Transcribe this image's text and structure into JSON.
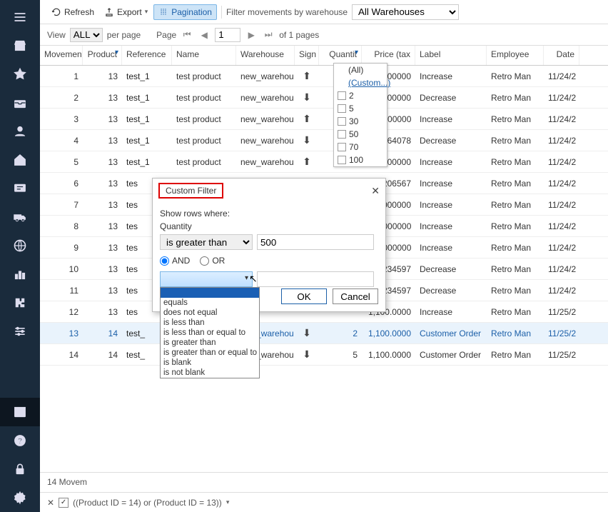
{
  "sidebar": {
    "items": [
      "menu",
      "store",
      "star",
      "inbox",
      "user",
      "home",
      "chat",
      "truck",
      "globe",
      "chart",
      "puzzle",
      "sliders",
      "archive",
      "help",
      "lock",
      "gear"
    ]
  },
  "toolbar": {
    "refresh": "Refresh",
    "export": "Export",
    "pagination": "Pagination",
    "filter_label": "Filter movements by warehouse",
    "warehouse_selected": "All Warehouses"
  },
  "pager": {
    "view": "View",
    "all": "ALL",
    "perpage": "per page",
    "page": "Page",
    "current": "1",
    "of": "of 1 pages"
  },
  "columns": {
    "movement": "Movement",
    "product": "Product",
    "reference": "Reference",
    "name": "Name",
    "warehouse": "Warehouse",
    "sign": "Sign",
    "quantity": "Quantit",
    "price": "Price (tax",
    "label": "Label",
    "employee": "Employee",
    "date": "Date"
  },
  "rows": [
    {
      "mov": "1",
      "prod": "13",
      "ref": "test_1",
      "name": "test product",
      "wh": "new_warehou",
      "sign": "up",
      "qty": "",
      "price": "111.000000",
      "label": "Increase",
      "emp": "Retro Man",
      "date": "11/24/2"
    },
    {
      "mov": "2",
      "prod": "13",
      "ref": "test_1",
      "name": "test product",
      "wh": "new_warehou",
      "sign": "down",
      "qty": "",
      "price": "111.000000",
      "label": "Decrease",
      "emp": "Retro Man",
      "date": "11/24/2"
    },
    {
      "mov": "3",
      "prod": "13",
      "ref": "test_1",
      "name": "test product",
      "wh": "new_warehou",
      "sign": "up",
      "qty": "",
      "price": "120.000000",
      "label": "Increase",
      "emp": "Retro Man",
      "date": "11/24/2"
    },
    {
      "mov": "4",
      "prod": "13",
      "ref": "test_1",
      "name": "test product",
      "wh": "new_warehou",
      "sign": "down",
      "qty": "",
      "price": "118.864078",
      "label": "Decrease",
      "emp": "Retro Man",
      "date": "11/24/2"
    },
    {
      "mov": "5",
      "prod": "13",
      "ref": "test_1",
      "name": "test product",
      "wh": "new_warehou",
      "sign": "up",
      "qty": "",
      "price": "110.000000",
      "label": "Increase",
      "emp": "Retro Man",
      "date": "11/24/2"
    },
    {
      "mov": "6",
      "prod": "13",
      "ref": "tes",
      "name": "",
      "wh": "",
      "sign": "",
      "qty": "",
      "price": "117.206567",
      "label": "Increase",
      "emp": "Retro Man",
      "date": "11/24/2"
    },
    {
      "mov": "7",
      "prod": "13",
      "ref": "tes",
      "name": "",
      "wh": "",
      "sign": "",
      "qty": "",
      "price": "110.000000",
      "label": "Increase",
      "emp": "Retro Man",
      "date": "11/24/2"
    },
    {
      "mov": "8",
      "prod": "13",
      "ref": "tes",
      "name": "",
      "wh": "",
      "sign": "",
      "qty": "",
      "price": "123.000000",
      "label": "Increase",
      "emp": "Retro Man",
      "date": "11/24/2"
    },
    {
      "mov": "9",
      "prod": "13",
      "ref": "tes",
      "name": "",
      "wh": "",
      "sign": "",
      "qty": "",
      "price": "125.000000",
      "label": "Increase",
      "emp": "Retro Man",
      "date": "11/24/2"
    },
    {
      "mov": "10",
      "prod": "13",
      "ref": "tes",
      "name": "",
      "wh": "",
      "sign": "",
      "qty": "",
      "price": "118.234597",
      "label": "Decrease",
      "emp": "Retro Man",
      "date": "11/24/2"
    },
    {
      "mov": "11",
      "prod": "13",
      "ref": "tes",
      "name": "",
      "wh": "",
      "sign": "",
      "qty": "",
      "price": "118.234597",
      "label": "Decrease",
      "emp": "Retro Man",
      "date": "11/24/2"
    },
    {
      "mov": "12",
      "prod": "13",
      "ref": "tes",
      "name": "",
      "wh": "",
      "sign": "",
      "qty": "",
      "price": "1,100.0000",
      "label": "Increase",
      "emp": "Retro Man",
      "date": "11/25/2"
    },
    {
      "mov": "13",
      "prod": "14",
      "ref": "test_",
      "name": "",
      "wh": "new_warehou",
      "sign": "down",
      "qty": "2",
      "price": "1,100.0000",
      "label": "Customer Order",
      "emp": "Retro Man",
      "date": "11/25/2",
      "hl": true
    },
    {
      "mov": "14",
      "prod": "14",
      "ref": "test_",
      "name": "",
      "wh": "new_warehou",
      "sign": "down",
      "qty": "5",
      "price": "1,100.0000",
      "label": "Customer Order",
      "emp": "Retro Man",
      "date": "11/25/2"
    }
  ],
  "qty_filter": {
    "all": "(All)",
    "custom": "(Custom...)",
    "values": [
      "2",
      "5",
      "30",
      "50",
      "70",
      "100"
    ]
  },
  "modal": {
    "title": "Custom Filter",
    "show_rows": "Show rows where:",
    "field": "Quantity",
    "op1": "is greater than",
    "val1": "500",
    "and": "AND",
    "or": "OR",
    "ok": "OK",
    "cancel": "Cancel",
    "ops": [
      "equals",
      "does not equal",
      "is less than",
      "is less than or equal to",
      "is greater than",
      "is greater than or equal to",
      "is blank",
      "is not blank"
    ]
  },
  "footer": {
    "count": "14 Movem",
    "filter_expr": "((Product ID = 14) or (Product ID = 13))"
  }
}
